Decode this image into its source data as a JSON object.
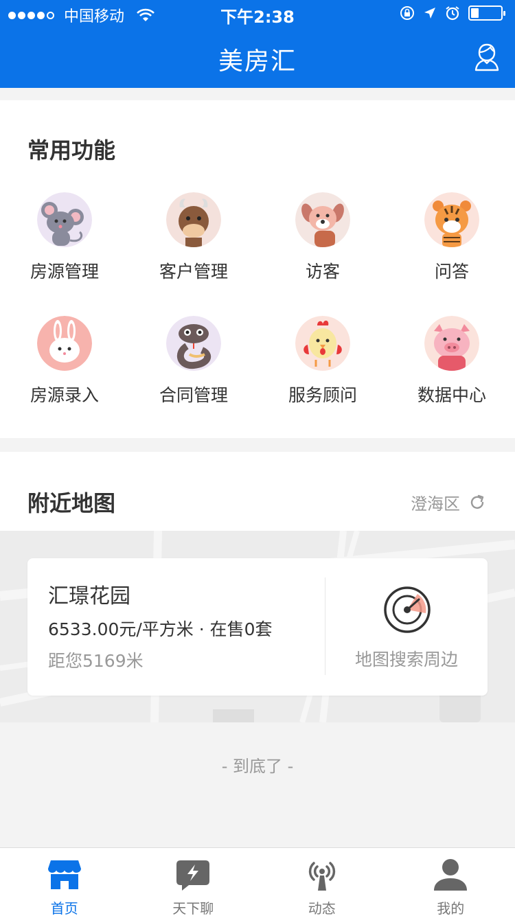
{
  "status_bar": {
    "carrier": "中国移动",
    "time": "下午2:38",
    "battery_level": 0.25
  },
  "navbar": {
    "title": "美房汇",
    "user_icon": "user-outline-icon"
  },
  "common_functions": {
    "title": "常用功能",
    "items": [
      {
        "label": "房源管理",
        "icon": "rat-icon"
      },
      {
        "label": "客户管理",
        "icon": "ox-icon"
      },
      {
        "label": "访客",
        "icon": "dog-icon"
      },
      {
        "label": "问答",
        "icon": "tiger-icon"
      },
      {
        "label": "房源录入",
        "icon": "rabbit-icon"
      },
      {
        "label": "合同管理",
        "icon": "snake-icon"
      },
      {
        "label": "服务顾问",
        "icon": "rooster-icon"
      },
      {
        "label": "数据中心",
        "icon": "pig-icon"
      }
    ]
  },
  "nearby_map": {
    "title": "附近地图",
    "district": "澄海区",
    "estate": {
      "name": "汇璟花园",
      "price_line": "6533.00元/平方米 · 在售0套",
      "distance": "距您5169米"
    },
    "search_label": "地图搜索周边"
  },
  "footer_text": "- 到底了 -",
  "tabbar": {
    "tabs": [
      {
        "label": "首页",
        "icon": "home-store-icon",
        "active": true
      },
      {
        "label": "天下聊",
        "icon": "chat-lightning-icon",
        "active": false
      },
      {
        "label": "动态",
        "icon": "broadcast-icon",
        "active": false
      },
      {
        "label": "我的",
        "icon": "person-icon",
        "active": false
      }
    ]
  },
  "colors": {
    "primary": "#0b73e8",
    "background": "#f3f3f3",
    "text": "#333333",
    "muted": "#999999"
  }
}
